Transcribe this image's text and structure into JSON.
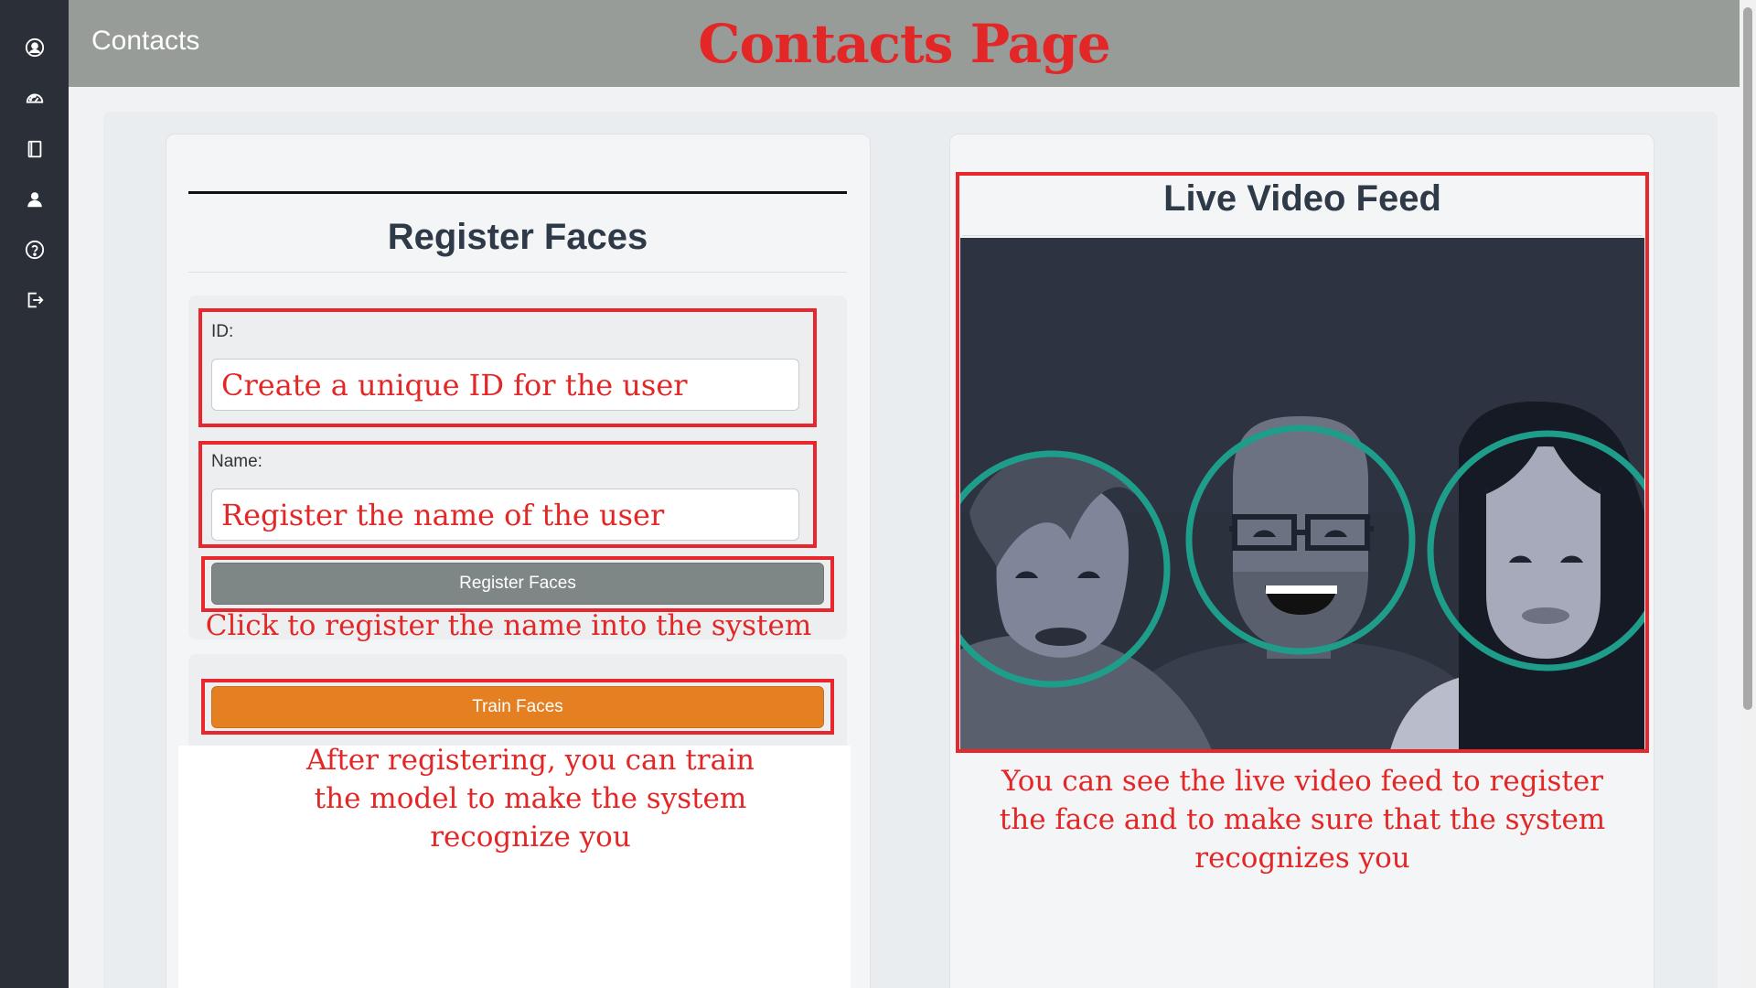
{
  "header": {
    "app_title": "Contacts",
    "annotation_title": "Contacts Page"
  },
  "sidebar": {
    "items": [
      {
        "icon": "user-circle-icon"
      },
      {
        "icon": "dashboard-gauge-icon"
      },
      {
        "icon": "book-icon"
      },
      {
        "icon": "person-icon"
      },
      {
        "icon": "help-circle-icon"
      },
      {
        "icon": "logout-icon"
      }
    ]
  },
  "register": {
    "title": "Register Faces",
    "id_label": "ID:",
    "id_placeholder": "Create a unique ID for the user",
    "name_label": "Name:",
    "name_placeholder": "Register the name of the user",
    "register_button": "Register Faces",
    "train_button": "Train Faces"
  },
  "video": {
    "title": "Live Video Feed"
  },
  "annotations": {
    "register_note": "Click to register the name into the system",
    "train_note_lines": [
      "After registering, you can train",
      "the model to make the system",
      "recognize you"
    ],
    "video_note_lines": [
      "You can see the live video feed to register",
      "the face and to make sure that the system",
      "recognizes you"
    ]
  },
  "colors": {
    "sidebar_bg": "#2b3038",
    "header_bg": "#979c98",
    "annotation_red": "#e32626",
    "register_button": "#7e8786",
    "train_button": "#e48022",
    "face_ring": "#1e9e8a"
  }
}
